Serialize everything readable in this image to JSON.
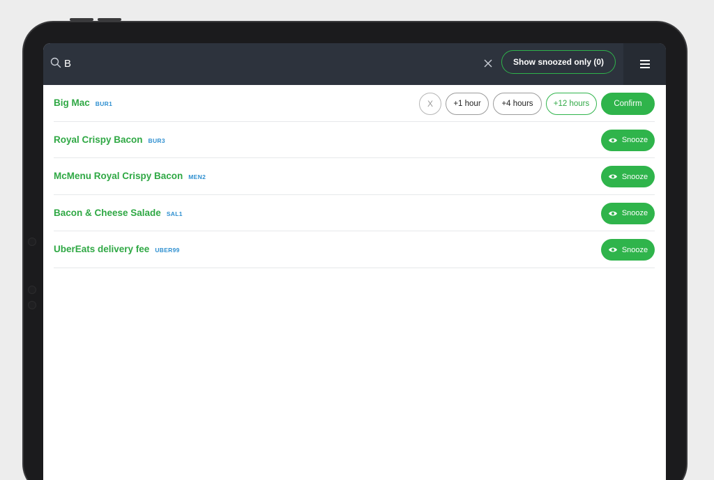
{
  "search": {
    "value": "B",
    "placeholder": ""
  },
  "toolbar": {
    "show_snoozed_label": "Show snoozed only (0)"
  },
  "items": [
    {
      "name": "Big Mac",
      "code": "BUR1",
      "expanded": true,
      "options": {
        "cancel": "X",
        "one_hour": "+1 hour",
        "four_hours": "+4 hours",
        "twelve_hours": "+12 hours",
        "confirm": "Confirm"
      },
      "selected_option": "+12 hours"
    },
    {
      "name": "Royal Crispy Bacon",
      "code": "BUR3",
      "snooze_label": "Snooze"
    },
    {
      "name": "McMenu Royal Crispy Bacon",
      "code": "MEN2",
      "snooze_label": "Snooze"
    },
    {
      "name": "Bacon & Cheese Salade",
      "code": "SAL1",
      "snooze_label": "Snooze"
    },
    {
      "name": "UberEats delivery fee",
      "code": "UBER99",
      "snooze_label": "Snooze"
    }
  ],
  "colors": {
    "accent": "#2fb44b",
    "item_name": "#2fa844",
    "code": "#2e8fd0",
    "topbar": "#2d333d"
  },
  "icons": {
    "search": "search-icon",
    "clear": "close-icon",
    "menu": "hamburger-menu-icon",
    "snooze": "eye-icon"
  }
}
